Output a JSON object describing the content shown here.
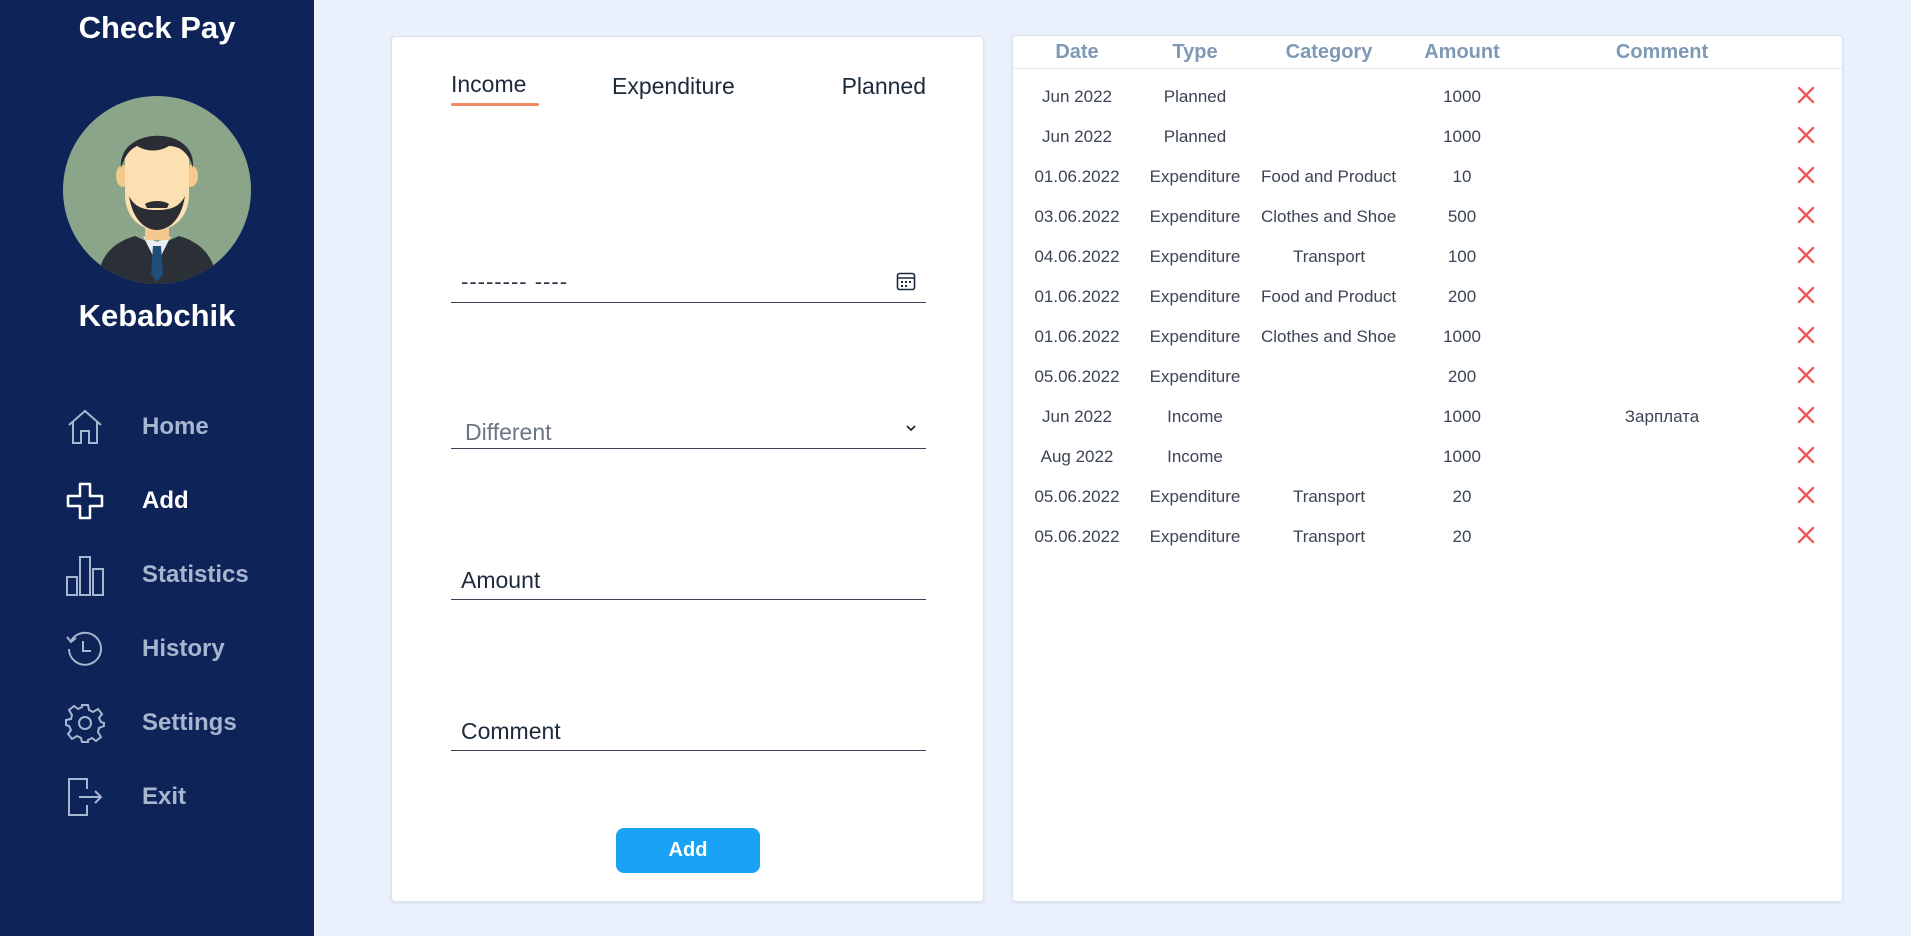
{
  "app": {
    "title": "Check Pay"
  },
  "user": {
    "name": "Kebabchik"
  },
  "nav": {
    "items": [
      {
        "label": "Home",
        "icon": "home-icon"
      },
      {
        "label": "Add",
        "icon": "plus-icon"
      },
      {
        "label": "Statistics",
        "icon": "bar-chart-icon"
      },
      {
        "label": "History",
        "icon": "history-icon"
      },
      {
        "label": "Settings",
        "icon": "gear-icon"
      },
      {
        "label": "Exit",
        "icon": "exit-icon"
      }
    ],
    "active": "Add"
  },
  "form": {
    "tabs": [
      "Income",
      "Expenditure",
      "Planned"
    ],
    "active_tab": "Income",
    "date_value": "-------- ----",
    "category_value": "Different",
    "amount_placeholder": "Amount",
    "comment_placeholder": "Comment",
    "submit_label": "Add"
  },
  "table": {
    "columns": [
      "Date",
      "Type",
      "Category",
      "Amount",
      "Comment"
    ],
    "rows": [
      {
        "date": "Jun 2022",
        "type": "Planned",
        "category": "",
        "amount": "1000",
        "comment": ""
      },
      {
        "date": "Jun 2022",
        "type": "Planned",
        "category": "",
        "amount": "1000",
        "comment": ""
      },
      {
        "date": "01.06.2022",
        "type": "Expenditure",
        "category": "Food and Products",
        "amount": "10",
        "comment": ""
      },
      {
        "date": "03.06.2022",
        "type": "Expenditure",
        "category": "Clothes and Shoes",
        "amount": "500",
        "comment": ""
      },
      {
        "date": "04.06.2022",
        "type": "Expenditure",
        "category": "Transport",
        "amount": "100",
        "comment": ""
      },
      {
        "date": "01.06.2022",
        "type": "Expenditure",
        "category": "Food and Products",
        "amount": "200",
        "comment": ""
      },
      {
        "date": "01.06.2022",
        "type": "Expenditure",
        "category": "Clothes and Shoes",
        "amount": "1000",
        "comment": ""
      },
      {
        "date": "05.06.2022",
        "type": "Expenditure",
        "category": "",
        "amount": "200",
        "comment": ""
      },
      {
        "date": "Jun 2022",
        "type": "Income",
        "category": "",
        "amount": "1000",
        "comment": "Зарплата"
      },
      {
        "date": "Aug 2022",
        "type": "Income",
        "category": "",
        "amount": "1000",
        "comment": ""
      },
      {
        "date": "05.06.2022",
        "type": "Expenditure",
        "category": "Transport",
        "amount": "20",
        "comment": ""
      },
      {
        "date": "05.06.2022",
        "type": "Expenditure",
        "category": "Transport",
        "amount": "20",
        "comment": ""
      }
    ],
    "delete_icon": "close-icon"
  },
  "colors": {
    "sidebar": "#0e2459",
    "background": "#eaf1fd",
    "accent": "#1aa3f5",
    "tab_underline": "#ef8a64",
    "delete": "#ef5b5b",
    "header_text": "#7e99b6"
  }
}
